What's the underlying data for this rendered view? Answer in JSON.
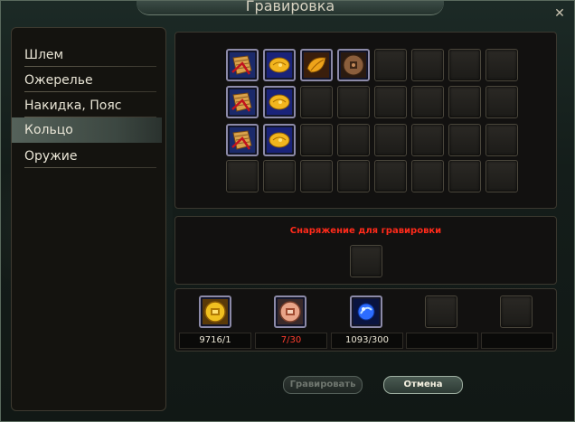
{
  "window": {
    "title": "Гравировка"
  },
  "menu": {
    "items": [
      {
        "label": "Шлем",
        "selected": false
      },
      {
        "label": "Ожерелье",
        "selected": false
      },
      {
        "label": "Накидка, Пояс",
        "selected": false
      },
      {
        "label": "Кольцо",
        "selected": true
      },
      {
        "label": "Оружие",
        "selected": false
      }
    ]
  },
  "inventory": {
    "rows": 4,
    "cols": 8,
    "items": [
      [
        "scroll-icon",
        "gold-seed-icon",
        "gold-leaf-icon",
        "bronze-coin-icon",
        "",
        "",
        "",
        ""
      ],
      [
        "scroll-icon",
        "gold-seed-icon",
        "",
        "",
        "",
        "",
        "",
        ""
      ],
      [
        "scroll-icon",
        "gold-seed-icon",
        "",
        "",
        "",
        "",
        "",
        ""
      ],
      [
        "",
        "",
        "",
        "",
        "",
        "",
        "",
        ""
      ]
    ]
  },
  "equipment": {
    "label": "Снаряжение для гравировки"
  },
  "materials": [
    {
      "icon": "gold-coin-icon",
      "count": "9716/1",
      "insufficient": false
    },
    {
      "icon": "copper-coin-icon",
      "count": "7/30",
      "insufficient": true
    },
    {
      "icon": "blue-orb-icon",
      "count": "1093/300",
      "insufficient": false
    },
    {
      "icon": "",
      "count": "",
      "insufficient": false
    },
    {
      "icon": "",
      "count": "",
      "insufficient": false
    }
  ],
  "buttons": {
    "engrave": "Гравировать",
    "cancel": "Отмена"
  },
  "colors": {
    "warning": "#ff2a1a",
    "selected_item": "#55625a"
  }
}
